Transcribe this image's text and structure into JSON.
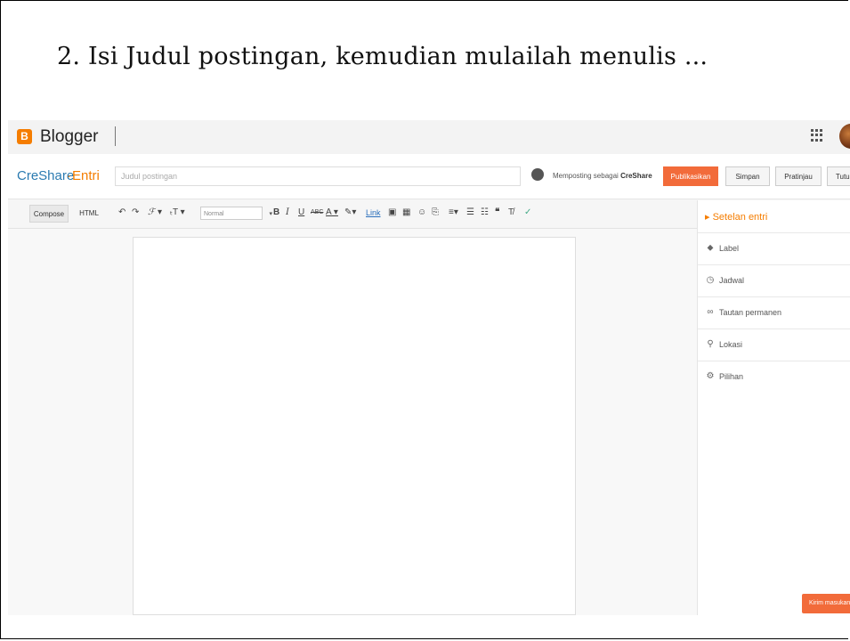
{
  "slide": {
    "title": "2. Isi Judul postingan, kemudian mulailah menulis ..."
  },
  "topbar": {
    "logo_letter": "B",
    "app_name": "Blogger",
    "icons": [
      "apps-grid-icon",
      "account-avatar"
    ]
  },
  "titlebar": {
    "blog_name": "CreShare",
    "separator": "·",
    "entry_label": "Entri",
    "title_placeholder": "Judul postingan",
    "posting_as_prefix": "Memposting sebagai",
    "posting_as_name": "CreShare",
    "buttons": {
      "publish": "Publikasikan",
      "save": "Simpan",
      "preview": "Pratinjau",
      "close": "Tutup"
    }
  },
  "toolbar": {
    "mode_compose": "Compose",
    "mode_html": "HTML",
    "font_icon": "ℱ ▾",
    "size_icon": "ₜT ▾",
    "format_select": "Normal",
    "bold": "B",
    "italic": "I",
    "underline": "U",
    "strike": "ABC",
    "text_color": "A ▾",
    "link": "Link"
  },
  "sidebar": {
    "header": "▸ Setelan entri",
    "items": [
      {
        "label": "Label",
        "icon": "tag-icon"
      },
      {
        "label": "Jadwal",
        "icon": "clock-icon"
      },
      {
        "label": "Tautan permanen",
        "icon": "link-icon"
      },
      {
        "label": "Lokasi",
        "icon": "location-pin-icon"
      },
      {
        "label": "Pilihan",
        "icon": "gear-icon"
      }
    ]
  },
  "send_feedback": "Kirim masukan",
  "colors": {
    "accent": "#f57d00",
    "publish": "#f26b3a",
    "blog_link": "#2a7ab0"
  }
}
